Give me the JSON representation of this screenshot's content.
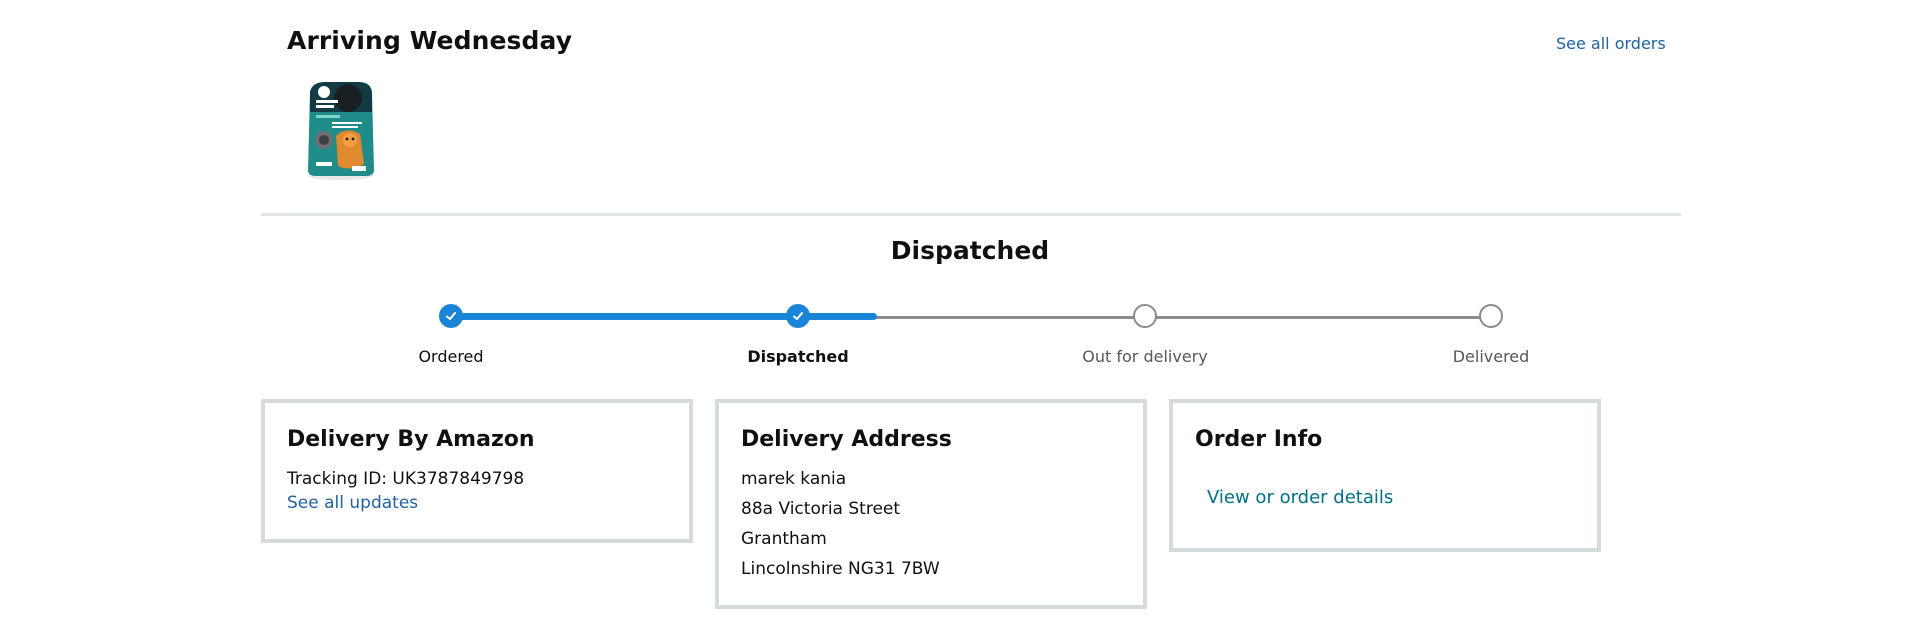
{
  "header": {
    "arrival_title": "Arriving Wednesday",
    "see_all_orders": "See all orders"
  },
  "product": {
    "image_icon": "cat-litter-bag-icon"
  },
  "tracker": {
    "status_title": "Dispatched",
    "progress_fraction": 0.41,
    "steps": [
      {
        "label": "Ordered",
        "state": "done"
      },
      {
        "label": "Dispatched",
        "state": "current"
      },
      {
        "label": "Out for delivery",
        "state": "todo"
      },
      {
        "label": "Delivered",
        "state": "todo"
      }
    ]
  },
  "cards": {
    "delivery_by": {
      "title": "Delivery By Amazon",
      "tracking_id": "Tracking ID: UK3787849798",
      "see_updates": "See all updates"
    },
    "address": {
      "title": "Delivery Address",
      "lines": [
        "marek kania",
        "88a Victoria Street",
        "Grantham",
        "Lincolnshire NG31 7BW"
      ]
    },
    "order_info": {
      "title": "Order Info",
      "link": "View or order details"
    }
  },
  "colors": {
    "progress_blue": "#1a85d6",
    "link_blue": "#2162a1",
    "link_teal": "#007185",
    "card_border": "#d5dbdb"
  }
}
